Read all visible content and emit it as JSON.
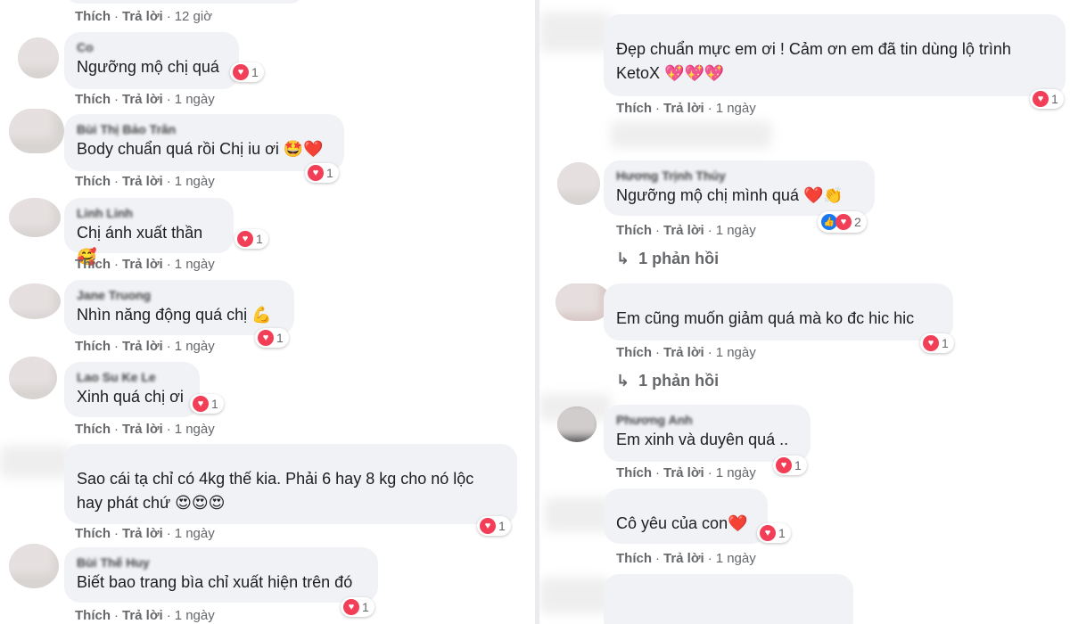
{
  "icons": {
    "heart": "heart-reaction-icon",
    "like": "like-reaction-icon",
    "reply_arrow": "reply-arrow-icon"
  },
  "colors": {
    "bubble": "#f0f2f5",
    "heart": "#f33e58",
    "like": "#1877f2",
    "meta": "#65676b"
  },
  "left": {
    "top_actions": {
      "like": "Thích",
      "reply": "Trả lời",
      "time": "12 giờ"
    },
    "comments": [
      {
        "name": "Co",
        "text": "Ngưỡng mộ chị quá",
        "reactions": "1",
        "like": "Thích",
        "reply": "Trả lời",
        "time": "1 ngày"
      },
      {
        "name": "Bùi Thị Bảo Trân",
        "text": "Body chuẩn quá rồi Chị iu ơi 🤩❤️",
        "reactions": "1",
        "like": "Thích",
        "reply": "Trả lời",
        "time": "1 ngày"
      },
      {
        "name": "Linh Linh",
        "text": "Chị ánh xuất thần 🥰",
        "reactions": "1",
        "like": "Thích",
        "reply": "Trả lời",
        "time": "1 ngày"
      },
      {
        "name": "Jane Truong",
        "text": "Nhìn năng động quá chị 💪",
        "reactions": "1",
        "like": "Thích",
        "reply": "Trả lời",
        "time": "1 ngày"
      },
      {
        "name": "Lao Su Ke Le",
        "text": "Xinh quá chị ơi",
        "reactions": "1",
        "like": "Thích",
        "reply": "Trả lời",
        "time": "1 ngày"
      },
      {
        "name": "",
        "text_line1": "Sao cái tạ chỉ có 4kg thế kia. Phải 6 hay 8 kg cho nó lộc",
        "text_line2": "hay phát chứ 😍😍😍",
        "reactions": "1",
        "like": "Thích",
        "reply": "Trả lời",
        "time": "1 ngày"
      },
      {
        "name": "Bùi Thế Huy",
        "text": "Biết bao trang bìa chỉ xuất hiện trên đó",
        "reactions": "1",
        "like": "Thích",
        "reply": "Trả lời",
        "time": "1 ngày"
      }
    ]
  },
  "right": {
    "comments": [
      {
        "name": "",
        "text_line1": "Đẹp chuẩn mực em ơi ! Cảm ơn em đã tin dùng lộ trình",
        "text_line2": "KetoX 💖💖💖",
        "reactions": "1",
        "like": "Thích",
        "reply": "Trả lời",
        "time": "1 ngày"
      },
      {
        "name": "Hương Trịnh Thủy",
        "text": "Ngưỡng mộ chị mình quá ❤️👏",
        "reactions": "2",
        "like": "Thích",
        "reply": "Trả lời",
        "time": "1 ngày",
        "replies": "1 phản hồi"
      },
      {
        "name": "",
        "text": "Em cũng muốn giảm quá mà ko đc hic hic",
        "reactions": "1",
        "like": "Thích",
        "reply": "Trả lời",
        "time": "1 ngày",
        "replies": "1 phản hồi"
      },
      {
        "name": "Phương Anh",
        "text": "Em xinh và duyên quá ..",
        "reactions": "1",
        "like": "Thích",
        "reply": "Trả lời",
        "time": "1 ngày"
      },
      {
        "name": "",
        "text": "Cô yêu của con❤️",
        "reactions": "1",
        "like": "Thích",
        "reply": "Trả lời",
        "time": "1 ngày"
      }
    ]
  }
}
